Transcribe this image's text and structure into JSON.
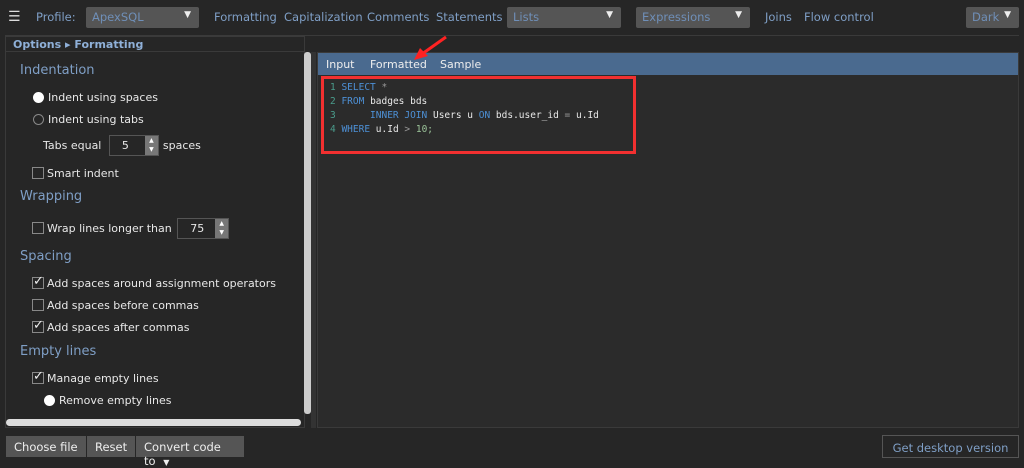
{
  "topbar": {
    "profile_label": "Profile:",
    "profile_value": "ApexSQL",
    "links": [
      "Formatting",
      "Capitalization",
      "Comments",
      "Statements"
    ],
    "lists": "Lists",
    "expressions": "Expressions",
    "joins": "Joins",
    "flow_control": "Flow control",
    "theme": "Dark"
  },
  "breadcrumb": {
    "root": "Options",
    "current": "Formatting"
  },
  "options": {
    "indentation": "Indentation",
    "indent_spaces": "Indent using spaces",
    "indent_tabs": "Indent using tabs",
    "tabs_equal": "Tabs equal",
    "tabs_value": "5",
    "spaces": "spaces",
    "smart_indent": "Smart indent",
    "wrapping": "Wrapping",
    "wrap_lines": "Wrap lines longer than",
    "wrap_value": "75",
    "spacing": "Spacing",
    "spaces_assign": "Add spaces around assignment operators",
    "spaces_before_commas": "Add spaces before commas",
    "spaces_after_commas": "Add spaces after commas",
    "empty_lines": "Empty lines",
    "manage_empty": "Manage empty lines",
    "remove_empty": "Remove empty lines"
  },
  "editor": {
    "tabs": [
      "Input",
      "Formatted",
      "Sample"
    ],
    "active_tab": "Formatted",
    "lines": [
      [
        {
          "t": "SELECT",
          "c": "kw"
        },
        {
          "t": " *",
          "c": "op"
        }
      ],
      [
        {
          "t": "FROM",
          "c": "kw"
        },
        {
          "t": " badges bds",
          "c": "tx"
        }
      ],
      [
        {
          "t": "     INNER JOIN",
          "c": "kw"
        },
        {
          "t": " Users u ",
          "c": "tx"
        },
        {
          "t": "ON",
          "c": "kw"
        },
        {
          "t": " bds.user_id ",
          "c": "tx"
        },
        {
          "t": "=",
          "c": "op"
        },
        {
          "t": " u.Id",
          "c": "tx"
        }
      ],
      [
        {
          "t": "WHERE",
          "c": "kw"
        },
        {
          "t": " u.Id ",
          "c": "tx"
        },
        {
          "t": ">",
          "c": "op"
        },
        {
          "t": " 10;",
          "c": "num"
        }
      ]
    ]
  },
  "footer": {
    "choose_file": "Choose file",
    "reset": "Reset",
    "convert": "Convert code to",
    "desktop": "Get desktop version"
  },
  "colors": {
    "accent": "#7f9fc6",
    "editor_header": "#4a6a8f",
    "highlight": "#ff2a2a"
  }
}
